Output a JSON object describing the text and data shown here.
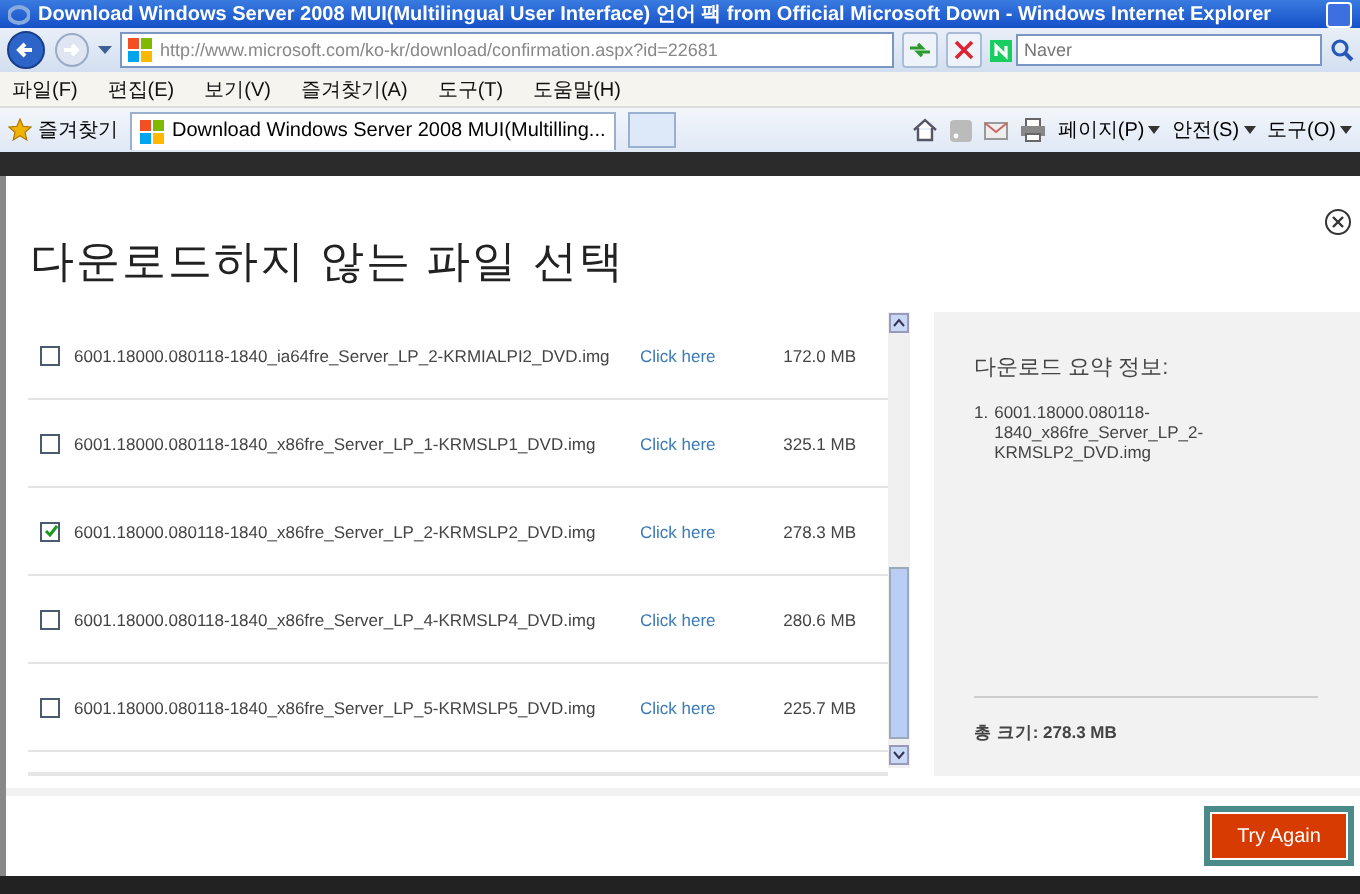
{
  "window": {
    "title": "Download Windows Server 2008 MUI(Multilingual User Interface) 언어 팩 from Official Microsoft Down - Windows Internet Explorer"
  },
  "address_bar": {
    "url": "http://www.microsoft.com/ko-kr/download/confirmation.aspx?id=22681",
    "search_placeholder": "Naver"
  },
  "menu": [
    "파일(F)",
    "편집(E)",
    "보기(V)",
    "즐겨찾기(A)",
    "도구(T)",
    "도움말(H)"
  ],
  "favorites": {
    "label": "즐겨찾기"
  },
  "tabs": [
    {
      "label": "Download Windows Server 2008 MUI(Multilling...",
      "selected": true
    }
  ],
  "command_bar": [
    "페이지(P)",
    "안전(S)",
    "도구(O)"
  ],
  "dialog": {
    "title": "다운로드하지 않는 파일 선택",
    "files": [
      {
        "name": "6001.18000.080118-1840_ia64fre_Server_LP_2-KRMIALPI2_DVD.img",
        "link": "Click here",
        "size": "172.0 MB",
        "checked": false
      },
      {
        "name": "6001.18000.080118-1840_x86fre_Server_LP_1-KRMSLP1_DVD.img",
        "link": "Click here",
        "size": "325.1 MB",
        "checked": false
      },
      {
        "name": "6001.18000.080118-1840_x86fre_Server_LP_2-KRMSLP2_DVD.img",
        "link": "Click here",
        "size": "278.3 MB",
        "checked": true
      },
      {
        "name": "6001.18000.080118-1840_x86fre_Server_LP_4-KRMSLP4_DVD.img",
        "link": "Click here",
        "size": "280.6 MB",
        "checked": false
      },
      {
        "name": "6001.18000.080118-1840_x86fre_Server_LP_5-KRMSLP5_DVD.img",
        "link": "Click here",
        "size": "225.7 MB",
        "checked": false
      }
    ],
    "summary": {
      "heading": "다운로드 요약 정보:",
      "items": [
        {
          "number": "1.",
          "name": "6001.18000.080118-1840_x86fre_Server_LP_2-KRMSLP2_DVD.img"
        }
      ],
      "total": "총 크기: 278.3 MB"
    },
    "button": "Try Again"
  }
}
